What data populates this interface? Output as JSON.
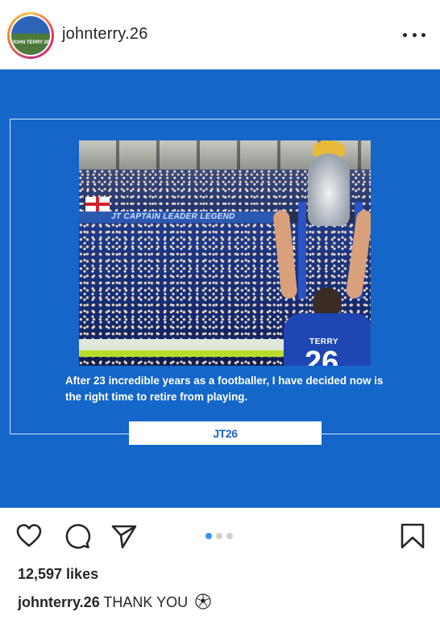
{
  "header": {
    "username": "johnterry.26",
    "avatar_text": "JOHN TERRY 26",
    "more_icon": "more-horizontal-icon"
  },
  "post": {
    "photo": {
      "banner_text": "JT CAPTAIN LEADER LEGEND",
      "shirt_name": "TERRY",
      "shirt_number": "26"
    },
    "statement": "After 23 incredible years as a footballer, I have decided now is the right time to retire from playing.",
    "signature": "JT26",
    "background_color": "#1466c8"
  },
  "actions": {
    "icons": [
      "heart-icon",
      "comment-icon",
      "share-icon",
      "bookmark-icon"
    ],
    "carousel": {
      "count": 3,
      "active_index": 0
    }
  },
  "likes": "12,597 likes",
  "caption": {
    "username": "johnterry.26",
    "text": "THANK YOU",
    "emoji_icon": "soccer-ball-icon"
  }
}
